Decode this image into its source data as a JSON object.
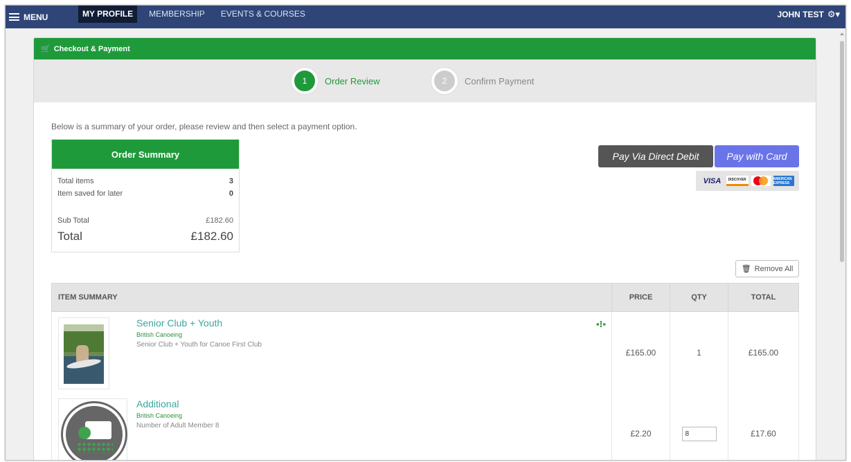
{
  "nav": {
    "menu_label": "MENU",
    "links": [
      "MY PROFILE",
      "MEMBERSHIP",
      "EVENTS & COURSES"
    ],
    "active_index": 0,
    "user_name": "JOHN TEST"
  },
  "card": {
    "header": "Checkout & Payment"
  },
  "steps": [
    {
      "num": "1",
      "label": "Order Review",
      "active": true
    },
    {
      "num": "2",
      "label": "Confirm Payment",
      "active": false
    }
  ],
  "intro": "Below is a summary of your order, please review and then select a payment option.",
  "summary": {
    "title": "Order Summary",
    "total_items_label": "Total items",
    "total_items": "3",
    "saved_label": "Item saved for later",
    "saved": "0",
    "subtotal_label": "Sub Total",
    "subtotal": "£182.60",
    "total_label": "Total",
    "total": "£182.60"
  },
  "payment": {
    "direct_debit_label": "Pay Via Direct Debit",
    "card_label": "Pay with Card",
    "card_logos": {
      "visa": "VISA",
      "discover": "DISCOVER",
      "amex": "AMERICAN EXPRESS"
    }
  },
  "remove_all_label": "Remove All",
  "table": {
    "headers": {
      "item": "ITEM SUMMARY",
      "price": "PRICE",
      "qty": "QTY",
      "total": "TOTAL"
    },
    "rows": [
      {
        "title": "Senior Club + Youth",
        "org": "British Canoeing",
        "desc": "Senior Club + Youth for Canoe First Club",
        "price": "£165.00",
        "qty": "1",
        "total": "£165.00"
      },
      {
        "title": "Additional",
        "org": "British Canoeing",
        "desc": "Number of Adult Member 8",
        "price": "£2.20",
        "qty": "8",
        "total": "£17.60"
      }
    ]
  },
  "colors": {
    "nav_bg": "#2f4577",
    "brand_green": "#1f9a3a",
    "card_button": "#6a74e8",
    "direct_debit_button": "#555555",
    "link_teal": "#3aa6a0"
  }
}
